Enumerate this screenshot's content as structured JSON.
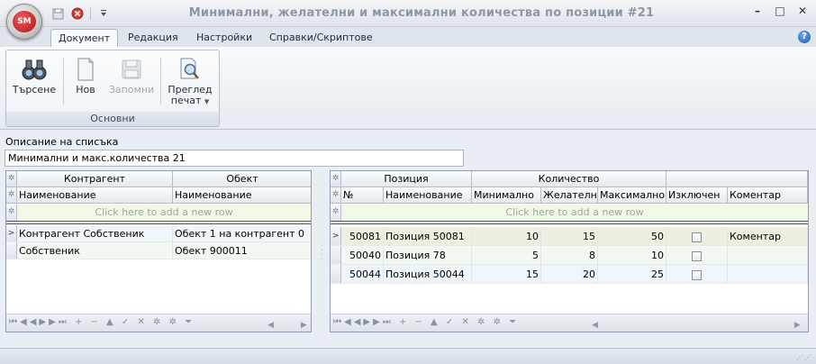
{
  "app": {
    "logo_text": "SM",
    "title": "Минимални, желателни и максимални количества по позиции #21",
    "window_controls": {
      "minimize": "–",
      "restore": "□",
      "close": "✕"
    }
  },
  "tabs": [
    {
      "label": "Документ",
      "active": true
    },
    {
      "label": "Редакция",
      "active": false
    },
    {
      "label": "Настройки",
      "active": false
    },
    {
      "label": "Справки/Скриптове",
      "active": false
    }
  ],
  "ribbon": {
    "group_caption": "Основни",
    "buttons": {
      "search": "Търсене",
      "new": "Нов",
      "save": "Запомни",
      "preview_line1": "Преглед",
      "preview_line2": "печат"
    }
  },
  "description": {
    "label": "Описание на списъка",
    "value": "Минимални и макс.количества 21"
  },
  "left_grid": {
    "band_headers": [
      "Контрагент",
      "Обект"
    ],
    "column_headers": [
      "Наименование",
      "Наименование"
    ],
    "new_row_text": "Click here to add a new row",
    "rows": [
      {
        "contragent": "Контрагент Собственик",
        "object": "Обект 1 на контрагент 0"
      },
      {
        "contragent": "Собственик",
        "object": "Обект 900011"
      }
    ]
  },
  "right_grid": {
    "band_headers": [
      "Позиция",
      "Количество"
    ],
    "column_headers": [
      "№",
      "Наименование",
      "Минимално",
      "Желателно",
      "Максимално",
      "Изключен",
      "Коментар"
    ],
    "new_row_text": "Click here to add a new row",
    "rows": [
      {
        "no": "50081",
        "name": "Позиция 50081",
        "min": "10",
        "desired": "15",
        "max": "50",
        "excluded": false,
        "comment": "Коментар"
      },
      {
        "no": "50040",
        "name": "Позиция 78",
        "min": "5",
        "desired": "8",
        "max": "10",
        "excluded": false,
        "comment": ""
      },
      {
        "no": "50044",
        "name": "Позиция 50044",
        "min": "15",
        "desired": "20",
        "max": "25",
        "excluded": false,
        "comment": ""
      }
    ]
  },
  "colors": {
    "accent": "#1f5aa8",
    "logo": "#b01515",
    "new_row_bg": "#f0f8e6"
  }
}
